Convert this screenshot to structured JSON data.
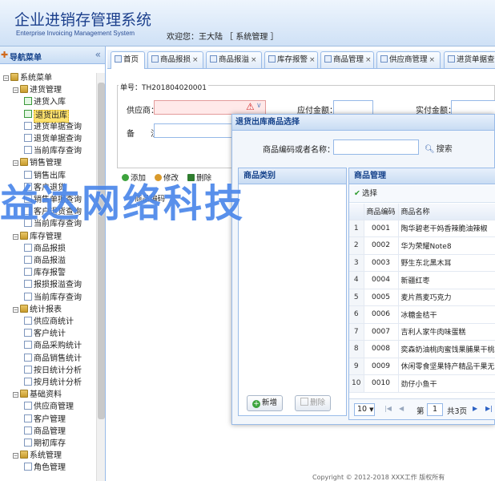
{
  "header": {
    "title": "企业进销存管理系统",
    "subtitle": "Enterprise Invoicing Management System",
    "welcome": "欢迎您：王大陆 ［ 系统管理 ］"
  },
  "sidebar": {
    "title": "导航菜单",
    "collapse_icon": "«",
    "tree": [
      {
        "label": "系统菜单",
        "level": 0,
        "type": "root"
      },
      {
        "label": "进货管理",
        "level": 1,
        "type": "folder"
      },
      {
        "label": "进货入库",
        "level": 2,
        "type": "page"
      },
      {
        "label": "退货出库",
        "level": 2,
        "type": "page",
        "selected": true
      },
      {
        "label": "进货单据查询",
        "level": 2,
        "type": "page"
      },
      {
        "label": "退货单据查询",
        "level": 2,
        "type": "page"
      },
      {
        "label": "当前库存查询",
        "level": 2,
        "type": "page"
      },
      {
        "label": "销售管理",
        "level": 1,
        "type": "folder"
      },
      {
        "label": "销售出库",
        "level": 2,
        "type": "page"
      },
      {
        "label": "客户退货",
        "level": 2,
        "type": "page"
      },
      {
        "label": "销售单据查询",
        "level": 2,
        "type": "page"
      },
      {
        "label": "客户退货查询",
        "level": 2,
        "type": "page"
      },
      {
        "label": "当前库存查询",
        "level": 2,
        "type": "page"
      },
      {
        "label": "库存管理",
        "level": 1,
        "type": "folder"
      },
      {
        "label": "商品报损",
        "level": 2,
        "type": "page"
      },
      {
        "label": "商品报溢",
        "level": 2,
        "type": "page"
      },
      {
        "label": "库存报警",
        "level": 2,
        "type": "page"
      },
      {
        "label": "报损报溢查询",
        "level": 2,
        "type": "page"
      },
      {
        "label": "当前库存查询",
        "level": 2,
        "type": "page"
      },
      {
        "label": "统计报表",
        "level": 1,
        "type": "folder"
      },
      {
        "label": "供应商统计",
        "level": 2,
        "type": "page"
      },
      {
        "label": "客户统计",
        "level": 2,
        "type": "page"
      },
      {
        "label": "商品采购统计",
        "level": 2,
        "type": "page"
      },
      {
        "label": "商品销售统计",
        "level": 2,
        "type": "page"
      },
      {
        "label": "按日统计分析",
        "level": 2,
        "type": "page"
      },
      {
        "label": "按月统计分析",
        "level": 2,
        "type": "page"
      },
      {
        "label": "基础资料",
        "level": 1,
        "type": "folder"
      },
      {
        "label": "供应商管理",
        "level": 2,
        "type": "page"
      },
      {
        "label": "客户管理",
        "level": 2,
        "type": "page"
      },
      {
        "label": "商品管理",
        "level": 2,
        "type": "page"
      },
      {
        "label": "期初库存",
        "level": 2,
        "type": "page"
      },
      {
        "label": "系统管理",
        "level": 1,
        "type": "folder"
      },
      {
        "label": "角色管理",
        "level": 2,
        "type": "page"
      }
    ]
  },
  "tabs": [
    {
      "label": "首页",
      "closable": false
    },
    {
      "label": "商品报损",
      "closable": true
    },
    {
      "label": "商品报溢",
      "closable": true
    },
    {
      "label": "库存报警",
      "closable": true
    },
    {
      "label": "商品管理",
      "closable": true
    },
    {
      "label": "供应商管理",
      "closable": true
    },
    {
      "label": "进货单据查询",
      "closable": false
    }
  ],
  "form": {
    "order_no": "单号：TH201804020001",
    "supplier_label": "供应商：",
    "payable_label": "应付金额：",
    "paid_label": "实付金额：",
    "remark_label": "备　　注：",
    "warn_icon": "⚠",
    "dropdown_icon": "∨"
  },
  "toolbar": {
    "add": "添加",
    "edit": "修改",
    "delete": "删除"
  },
  "grid_header": "商品编码",
  "dialog": {
    "title": "退货出库商品选择",
    "search_label": "商品编码或者名称：",
    "search_value": "",
    "search_button": "搜索",
    "category_panel_title": "商品类别",
    "add_button": "新增",
    "delete_button": "删除",
    "goods_panel_title": "商品管理",
    "select_button": "选择",
    "columns": [
      "商品编码",
      "商品名称"
    ],
    "rows": [
      {
        "idx": "1",
        "code": "0001",
        "name": "陶华碧老干妈香辣脆油辣椒"
      },
      {
        "idx": "2",
        "code": "0002",
        "name": "华为荣耀Note8"
      },
      {
        "idx": "3",
        "code": "0003",
        "name": "野生东北黑木耳"
      },
      {
        "idx": "4",
        "code": "0004",
        "name": "新疆红枣"
      },
      {
        "idx": "5",
        "code": "0005",
        "name": "麦片燕麦巧克力"
      },
      {
        "idx": "6",
        "code": "0006",
        "name": "冰糖金桔干"
      },
      {
        "idx": "7",
        "code": "0007",
        "name": "吉利人家牛肉味蛋糕"
      },
      {
        "idx": "8",
        "code": "0008",
        "name": "奕森奶油桃肉蜜饯果脯果干桃肉干"
      },
      {
        "idx": "9",
        "code": "0009",
        "name": "休闲零食坚果特产精品干果无漂白"
      },
      {
        "idx": "10",
        "code": "0010",
        "name": "劲仔小鱼干"
      }
    ],
    "pager": {
      "page_size": "10",
      "page_label": "第",
      "page_value": "1",
      "total_label": "共3页"
    }
  },
  "watermark": "益达网络科技",
  "footer": "Copyright © 2012-2018 XXX工作 版权所有"
}
